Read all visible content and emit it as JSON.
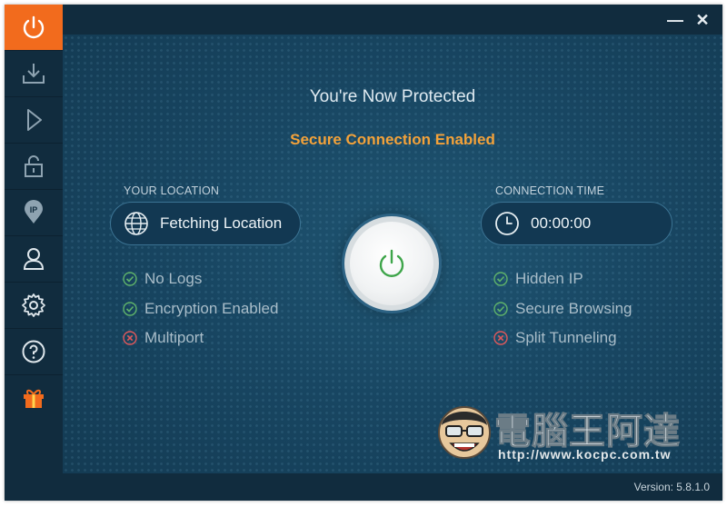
{
  "window": {
    "minimize_label": "—",
    "close_label": "✕"
  },
  "sidebar": {
    "items": [
      {
        "icon": "power-icon",
        "active": true
      },
      {
        "icon": "download-icon"
      },
      {
        "icon": "play-icon"
      },
      {
        "icon": "lock-icon"
      },
      {
        "icon": "ip-location-icon"
      },
      {
        "icon": "user-icon"
      },
      {
        "icon": "gear-icon"
      },
      {
        "icon": "help-icon"
      },
      {
        "icon": "gift-icon"
      }
    ]
  },
  "main": {
    "title": "You're Now Protected",
    "subtitle": "Secure Connection Enabled",
    "location": {
      "label": "YOUR LOCATION",
      "value": "Fetching Location"
    },
    "connection": {
      "label": "CONNECTION TIME",
      "value": "00:00:00"
    },
    "features_left": [
      {
        "text": "No Logs",
        "status": "enabled"
      },
      {
        "text": "Encryption Enabled",
        "status": "enabled"
      },
      {
        "text": "Multiport",
        "status": "disabled"
      }
    ],
    "features_right": [
      {
        "text": "Hidden IP",
        "status": "enabled"
      },
      {
        "text": "Secure Browsing",
        "status": "enabled"
      },
      {
        "text": "Split Tunneling",
        "status": "disabled"
      }
    ]
  },
  "footer": {
    "version": "Version:  5.8.1.0"
  },
  "watermark": {
    "text": "電腦王阿達",
    "url": "http://www.kocpc.com.tw"
  },
  "colors": {
    "accent": "#f26b1d",
    "enabled": "#5fb36a",
    "disabled": "#e0585b",
    "subtitle": "#f3a23a"
  }
}
